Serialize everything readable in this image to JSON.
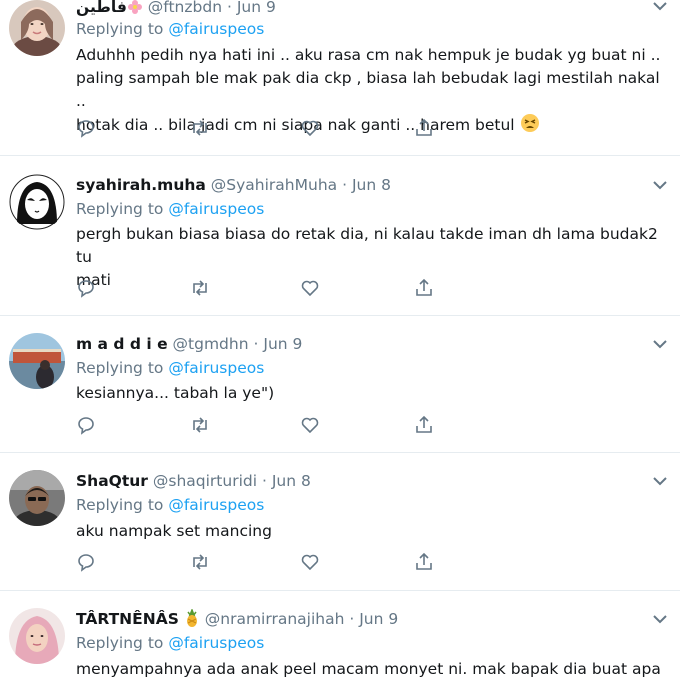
{
  "colors": {
    "link": "#1da1f2",
    "muted": "#657786",
    "text": "#14171a",
    "divider": "#e6ecf0"
  },
  "tweets": [
    {
      "display_name": "فاطين",
      "handle": "@ftnzbdn",
      "separator": "·",
      "date": "Jun 9",
      "replying_prefix": "Replying to",
      "replying_handle": "@fairuspeos",
      "text_lines": [
        "Aduhhh pedih nya hati ini .. aku rasa cm nak hempuk je budak yg buat ni ..",
        "paling sampah ble mak pak dia ckp , biasa lah bebudak lagi mestilah nakal ..",
        "hotak dia .. bila jadi cm ni siapa nak ganti .. harem betul"
      ],
      "emoji": "tired-face-emoji"
    },
    {
      "display_name": "syahirah.muha",
      "handle": "@SyahirahMuha",
      "separator": "·",
      "date": "Jun 8",
      "replying_prefix": "Replying to",
      "replying_handle": "@fairuspeos",
      "text_lines": [
        "pergh bukan biasa biasa do retak dia, ni kalau takde iman dh lama budak2 tu",
        "mati"
      ]
    },
    {
      "display_name": "m a d d i e",
      "handle": "@tgmdhn",
      "separator": "·",
      "date": "Jun 9",
      "replying_prefix": "Replying to",
      "replying_handle": "@fairuspeos",
      "text_lines": [
        "kesiannya... tabah la ye\")"
      ]
    },
    {
      "display_name": "ShaQtur",
      "handle": "@shaqirturidi",
      "separator": "·",
      "date": "Jun 8",
      "replying_prefix": "Replying to",
      "replying_handle": "@fairuspeos",
      "text_lines": [
        "aku nampak set mancing"
      ]
    },
    {
      "display_name": "TÂRTNÊNÂS",
      "handle": "@nramirranajihah",
      "separator": "·",
      "date": "Jun 9",
      "replying_prefix": "Replying to",
      "replying_handle": "@fairuspeos",
      "text_lines": [
        "menyampahnya ada anak peel macam monyet ni. mak bapak dia buat apa ek?"
      ],
      "emoji": "pineapple-emoji"
    }
  ],
  "icons": {
    "reply": "reply-icon",
    "retweet": "retweet-icon",
    "like": "heart-icon",
    "share": "share-icon",
    "more": "chevron-down-icon"
  }
}
